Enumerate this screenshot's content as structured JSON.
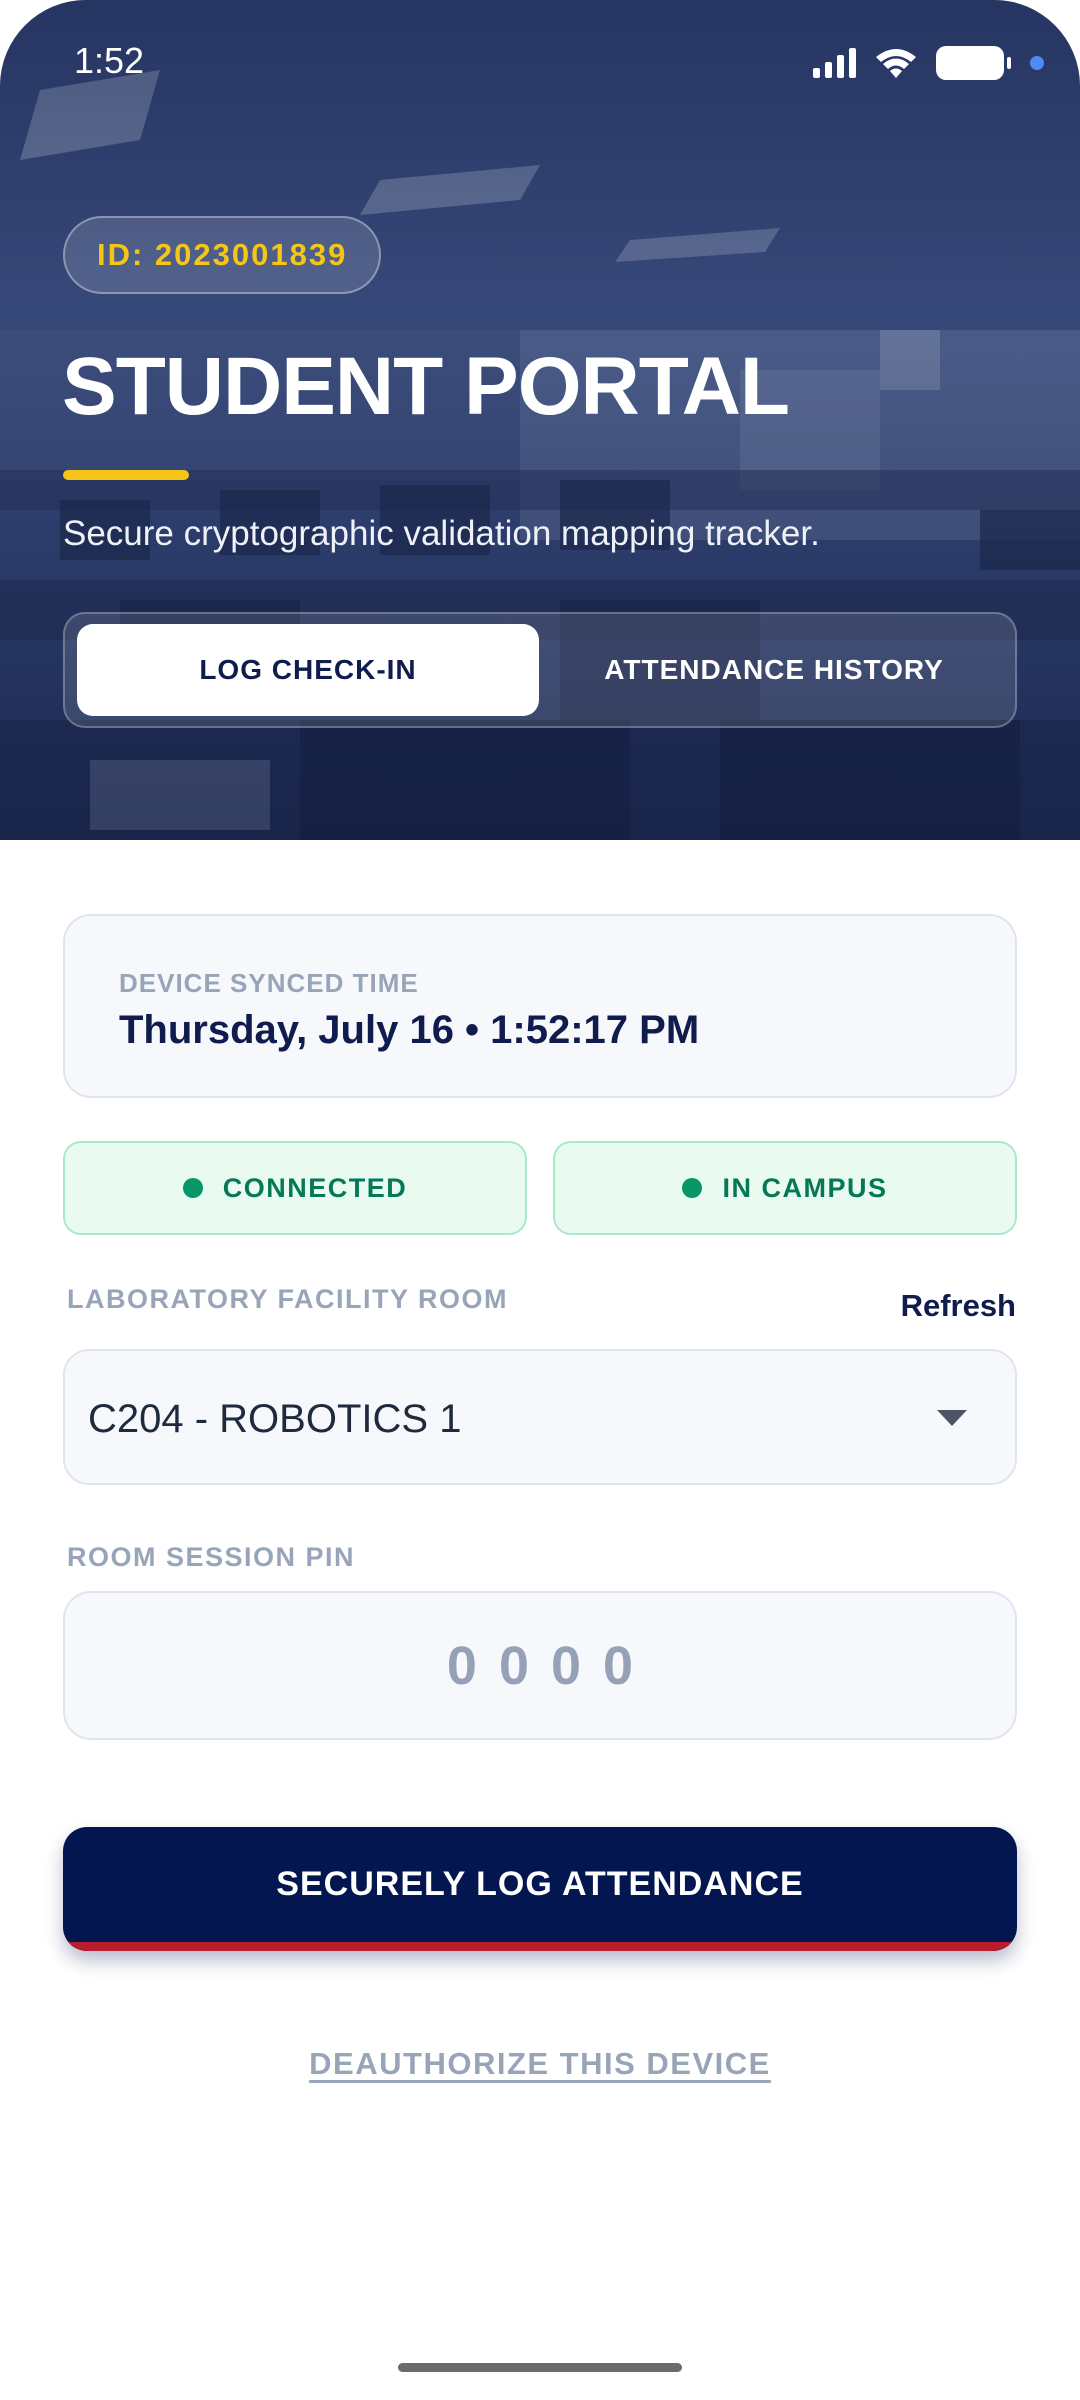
{
  "status_bar": {
    "time": "1:52"
  },
  "hero": {
    "student_id": "ID: 2023001839",
    "title": "STUDENT PORTAL",
    "subtitle": "Secure cryptographic validation mapping tracker.",
    "tabs": [
      {
        "label": "LOG CHECK-IN",
        "active": true
      },
      {
        "label": "ATTENDANCE HISTORY",
        "active": false
      }
    ]
  },
  "sync_card": {
    "label": "DEVICE SYNCED TIME",
    "value": "Thursday, July 16 • 1:52:17 PM"
  },
  "status_pills": [
    {
      "label": "CONNECTED",
      "color": "#069667"
    },
    {
      "label": "IN CAMPUS",
      "color": "#069667"
    }
  ],
  "room": {
    "label": "LABORATORY FACILITY ROOM",
    "refresh_label": "Refresh",
    "selected": "C204 - ROBOTICS 1"
  },
  "pin": {
    "label": "ROOM SESSION PIN",
    "placeholder": "0000"
  },
  "actions": {
    "submit_label": "SECURELY LOG ATTENDANCE",
    "deauthorize_label": "DEAUTHORIZE THIS DEVICE"
  },
  "colors": {
    "primary": "#041650",
    "accent_yellow": "#f5c518",
    "accent_red": "#b91c2c",
    "success": "#069667",
    "muted": "#98a5b9"
  }
}
